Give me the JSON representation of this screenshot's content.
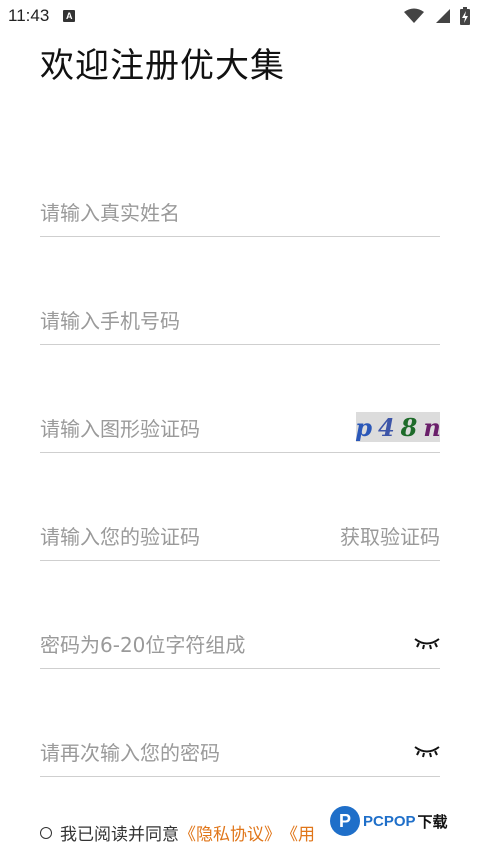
{
  "status_bar": {
    "time": "11:43",
    "badge": "A",
    "icons": [
      "wifi-icon",
      "signal-icon",
      "battery-icon"
    ]
  },
  "page": {
    "title": "欢迎注册优大集"
  },
  "form": {
    "name_placeholder": "请输入真实姓名",
    "phone_placeholder": "请输入手机号码",
    "captcha_placeholder": "请输入图形验证码",
    "captcha_chars": [
      "p",
      "4",
      "8",
      "n"
    ],
    "sms_placeholder": "请输入您的验证码",
    "get_code_label": "获取验证码",
    "password_placeholder": "密码为6-20位字符组成",
    "confirm_placeholder": "请再次输入您的密码"
  },
  "agreement": {
    "prefix": "我已阅读并同意",
    "privacy_link": "《隐私协议》",
    "service_link_visible": "《用"
  },
  "watermark": {
    "logo_letter": "P",
    "text": "PCPOP",
    "suffix": "下载"
  },
  "colors": {
    "link": "#e0761a",
    "placeholder": "#9a9a9a",
    "divider": "#cfcfcf",
    "captcha_bg": "#dcdcdc",
    "watermark_blue": "#1f6fc9"
  }
}
